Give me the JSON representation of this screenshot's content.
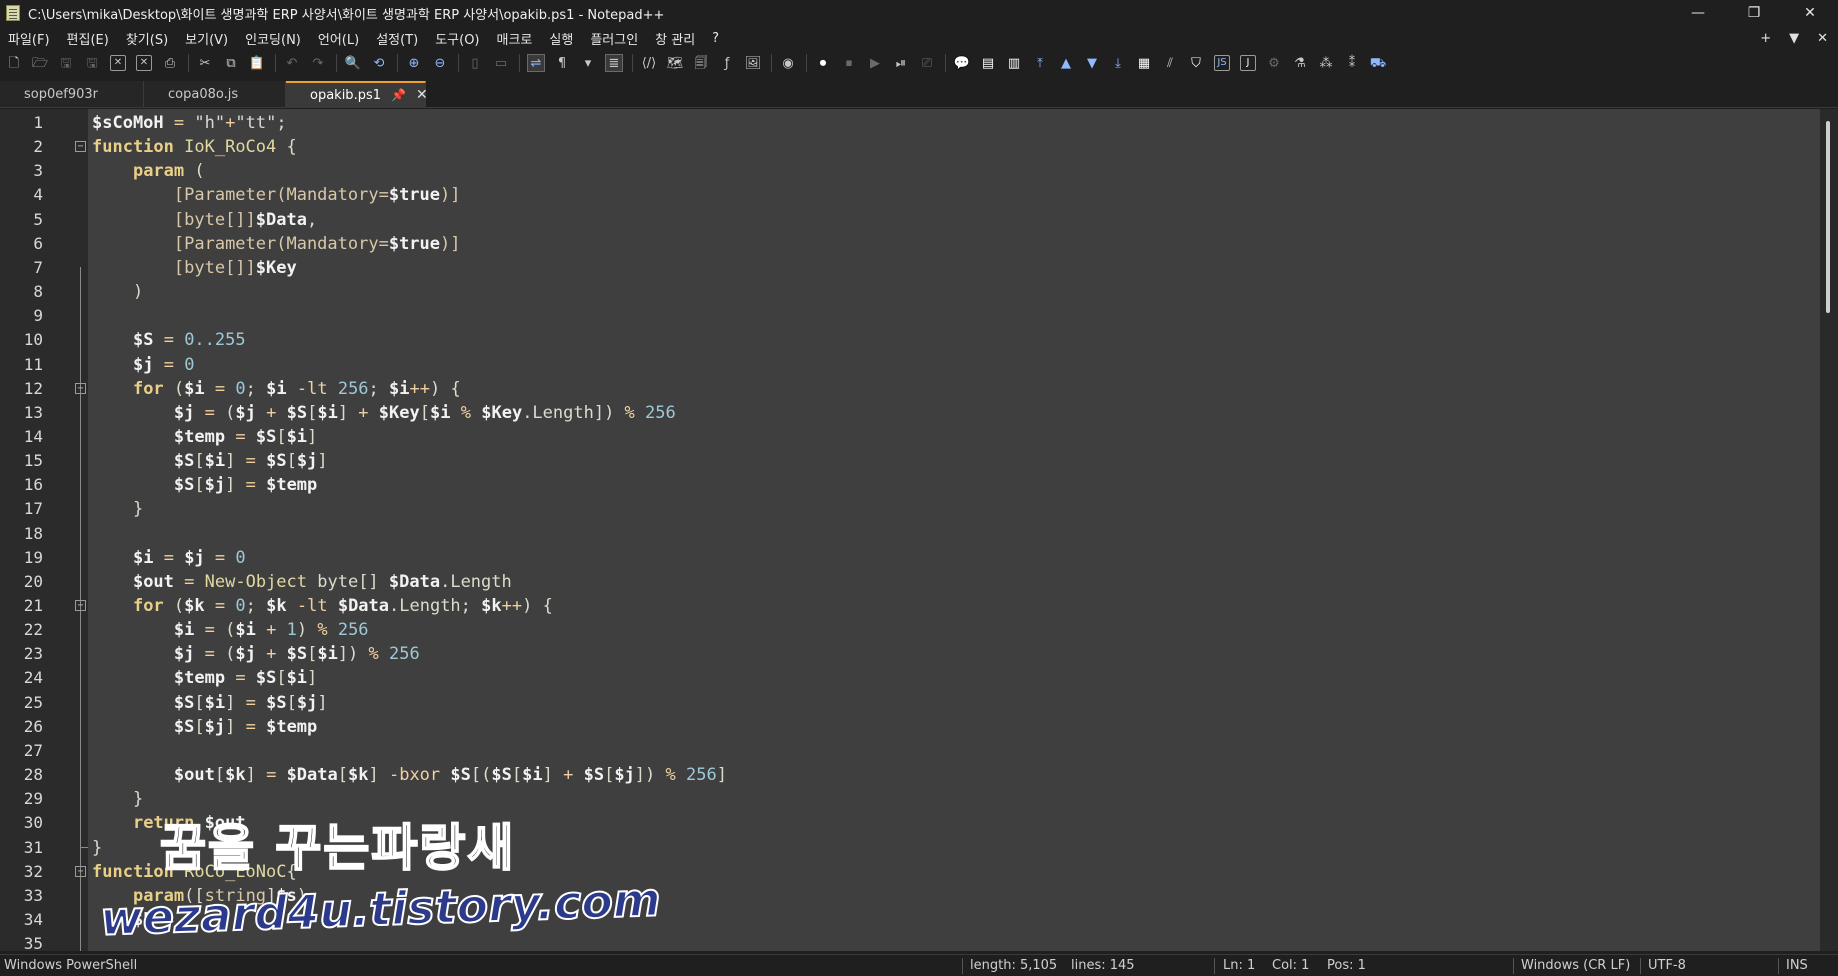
{
  "window": {
    "title": "C:\\Users\\mika\\Desktop\\화이트 생명과학 ERP 사양서\\화이트 생명과학 ERP 사양서\\opakib.ps1 - Notepad++",
    "minimize": "—",
    "restore": "❐",
    "close": "✕"
  },
  "menu": {
    "items": [
      "파일(F)",
      "편집(E)",
      "찾기(S)",
      "보기(V)",
      "인코딩(N)",
      "언어(L)",
      "설정(T)",
      "도구(O)",
      "매크로",
      "실행",
      "플러그인",
      "창 관리",
      "?"
    ],
    "right_plus": "+",
    "right_down": "▼",
    "right_close": "✕"
  },
  "tabs": [
    {
      "label": "sop0ef903r",
      "active": false
    },
    {
      "label": "copa08o.js",
      "active": false
    },
    {
      "label": "opakib.ps1",
      "active": true
    }
  ],
  "editor": {
    "line_numbers": [
      "1",
      "2",
      "3",
      "4",
      "5",
      "6",
      "7",
      "8",
      "9",
      "10",
      "11",
      "12",
      "13",
      "14",
      "15",
      "16",
      "17",
      "18",
      "19",
      "20",
      "21",
      "22",
      "23",
      "24",
      "25",
      "26",
      "27",
      "28",
      "29",
      "30",
      "31",
      "32",
      "33",
      "34",
      "35"
    ]
  },
  "watermark": {
    "line1": "꿈을 꾸는파랑새",
    "line2": "wezard4u.tistory.com"
  },
  "status": {
    "language": "Windows PowerShell",
    "length": "length: 5,105",
    "lines": "lines: 145",
    "ln": "Ln: 1",
    "col": "Col: 1",
    "pos": "Pos: 1",
    "eol": "Windows (CR LF)",
    "encoding": "UTF-8",
    "mode": "INS"
  },
  "colors": {
    "accent_tab": "#f0a030",
    "editor_bg": "#3f3f3f",
    "keyword": "#e8d088",
    "number": "#9ec8d8"
  }
}
